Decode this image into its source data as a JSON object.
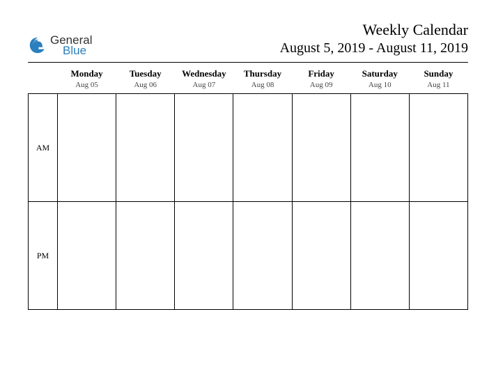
{
  "logo": {
    "line1": "General",
    "line2": "Blue"
  },
  "header": {
    "title": "Weekly Calendar",
    "date_range": "August 5, 2019 - August 11, 2019"
  },
  "days": [
    {
      "name": "Monday",
      "date": "Aug 05"
    },
    {
      "name": "Tuesday",
      "date": "Aug 06"
    },
    {
      "name": "Wednesday",
      "date": "Aug 07"
    },
    {
      "name": "Thursday",
      "date": "Aug 08"
    },
    {
      "name": "Friday",
      "date": "Aug 09"
    },
    {
      "name": "Saturday",
      "date": "Aug 10"
    },
    {
      "name": "Sunday",
      "date": "Aug 11"
    }
  ],
  "periods": {
    "am": "AM",
    "pm": "PM"
  }
}
